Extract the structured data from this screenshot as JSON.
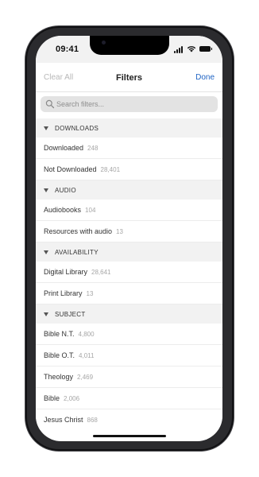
{
  "status_bar": {
    "time": "09:41",
    "icons": [
      "signal-icon",
      "wifi-icon",
      "battery-icon"
    ]
  },
  "nav": {
    "clear_all": "Clear All",
    "title": "Filters",
    "done": "Done"
  },
  "search": {
    "placeholder": "Search filters...",
    "value": "",
    "icon": "search-icon"
  },
  "colors": {
    "accent": "#1e63c4",
    "disabled": "#b8b8b8",
    "section_bg": "#f2f2f2",
    "count": "#a6a6a6"
  },
  "sections": [
    {
      "title": "DOWNLOADS",
      "items": [
        {
          "label": "Downloaded",
          "count": "248"
        },
        {
          "label": "Not Downloaded",
          "count": "28,401"
        }
      ]
    },
    {
      "title": "AUDIO",
      "items": [
        {
          "label": "Audiobooks",
          "count": "104"
        },
        {
          "label": "Resources with audio",
          "count": "13"
        }
      ]
    },
    {
      "title": "AVAILABILITY",
      "items": [
        {
          "label": "Digital Library",
          "count": "28,641"
        },
        {
          "label": "Print Library",
          "count": "13"
        }
      ]
    },
    {
      "title": "SUBJECT",
      "items": [
        {
          "label": "Bible N.T.",
          "count": "4,800"
        },
        {
          "label": "Bible O.T.",
          "count": "4,011"
        },
        {
          "label": "Theology",
          "count": "2,469"
        },
        {
          "label": "Bible",
          "count": "2,006"
        },
        {
          "label": "Jesus Christ",
          "count": "868"
        }
      ]
    }
  ]
}
